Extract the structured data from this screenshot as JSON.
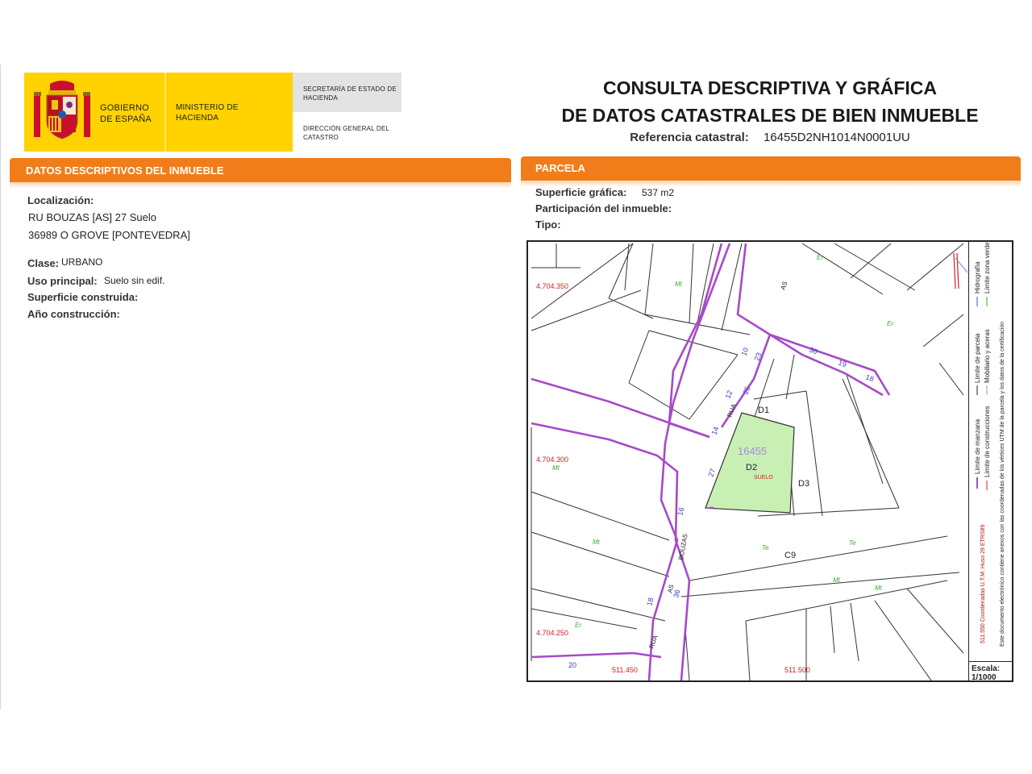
{
  "header": {
    "gobierno": "GOBIERNO DE ESPAÑA",
    "ministerio": "MINISTERIO DE HACIENDA",
    "secretaria": "SECRETARÍA DE ESTADO DE HACIENDA",
    "direccion": "DIRECCIÓN GENERAL DEL CATASTRO",
    "title_line1": "CONSULTA DESCRIPTIVA Y GRÁFICA",
    "title_line2": "DE DATOS CATASTRALES DE BIEN INMUEBLE",
    "ref_label": "Referencia catastral:",
    "ref_value": "16455D2NH1014N0001UU"
  },
  "descriptivos": {
    "heading": "DATOS DESCRIPTIVOS DEL INMUEBLE",
    "localizacion_label": "Localización:",
    "localizacion_line1": "RU BOUZAS [AS] 27 Suelo",
    "localizacion_line2": "36989 O GROVE [PONTEVEDRA]",
    "clase_label": "Clase:",
    "clase_value": "URBANO",
    "uso_label": "Uso principal:",
    "uso_value": "Suelo sin edif.",
    "superficie_label": "Superficie construida:",
    "anio_label": "Año construcción:"
  },
  "parcela": {
    "heading": "PARCELA",
    "superficie_label": "Superficie gráfica:",
    "superficie_value": "537 m2",
    "participacion_label": "Participación del inmueble:",
    "tipo_label": "Tipo:"
  },
  "map": {
    "coord_y1": "4.704.350",
    "coord_y2": "4.704.300",
    "coord_y3": "4.704.250",
    "coord_x1": "511.450",
    "coord_x2": "511.500",
    "parcel_id": "16455",
    "labels": {
      "d1": "D1",
      "d2": "D2",
      "d3": "D3",
      "c9": "C9",
      "suelo": "SUELO",
      "mt": "Mt",
      "er": "Er",
      "te": "Te",
      "rua": "RUA",
      "bouzas": "BOUZAS",
      "as": "AS"
    },
    "street_numbers": [
      "10",
      "12",
      "14",
      "23",
      "25",
      "27",
      "16",
      "18",
      "20",
      "30",
      "19",
      "18",
      "36"
    ],
    "legend_1": "Límite de manzana",
    "legend_2": "Límite de parcela",
    "legend_3": "Hidrografía",
    "legend_4": "Límite de construcciones",
    "legend_5": "Mobiliario y aceras",
    "legend_6": "Límite zona verde",
    "legend_coords": "511.550 Coordenadas U.T.M. Huso 29 ETRS89",
    "legend_note": "Este documento electrónico contiene anexos con las coordenadas de los vértices UTM de la parcela y los datos de la certificación",
    "scale_label": "Escala:",
    "scale_value": "1/1000"
  },
  "colors": {
    "orange": "#f07d19",
    "yellow": "#ffd200",
    "parcel_fill": "#c8f0b4",
    "block_line": "#a64ac9",
    "coord_red": "#d62020"
  }
}
